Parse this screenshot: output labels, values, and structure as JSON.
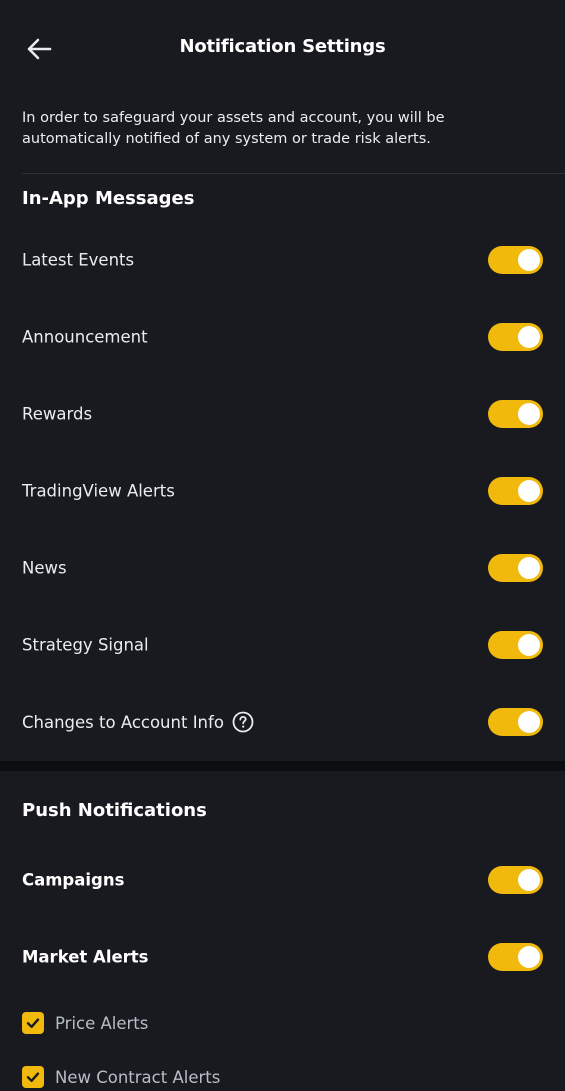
{
  "header": {
    "title": "Notification Settings",
    "back_icon": "arrow-left-icon"
  },
  "intro_text": "In order to safeguard your assets and account, you will be automatically notified of any system or trade risk alerts.",
  "colors": {
    "background": "#181a20",
    "accent": "#f0b90b",
    "text": "#eaecef"
  },
  "in_app": {
    "title": "In-App Messages",
    "items": [
      {
        "label": "Latest Events",
        "enabled": true
      },
      {
        "label": "Announcement",
        "enabled": true
      },
      {
        "label": "Rewards",
        "enabled": true
      },
      {
        "label": "TradingView Alerts",
        "enabled": true
      },
      {
        "label": "News",
        "enabled": true
      },
      {
        "label": "Strategy Signal",
        "enabled": true
      },
      {
        "label": "Changes to Account Info",
        "enabled": true,
        "icon": "help-circle-icon"
      }
    ]
  },
  "push": {
    "title": "Push Notifications",
    "items": [
      {
        "label": "Campaigns",
        "enabled": true
      },
      {
        "label": "Market Alerts",
        "enabled": true
      }
    ],
    "market_alert_options": [
      {
        "label": "Price Alerts",
        "checked": true
      },
      {
        "label": "New Contract Alerts",
        "checked": true
      }
    ]
  }
}
